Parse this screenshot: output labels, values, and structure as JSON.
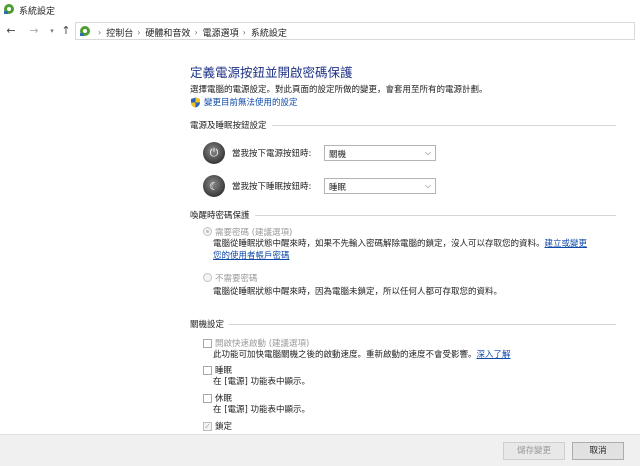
{
  "window": {
    "title": "系統設定"
  },
  "breadcrumb": {
    "items": [
      "控制台",
      "硬體和音效",
      "電源選項",
      "系統設定"
    ]
  },
  "page": {
    "heading": "定義電源按鈕並開啟密碼保護",
    "description": "選擇電腦的電源設定。對此頁面的設定所做的變更，會套用至所有的電源計劃。",
    "admin_link": "變更目前無法使用的設定"
  },
  "power_buttons": {
    "group_title": "電源及睡眠按鈕設定",
    "power_label": "當我按下電源按鈕時:",
    "power_value": "關機",
    "sleep_label": "當我按下睡眠按鈕時:",
    "sleep_value": "睡眠"
  },
  "wake_password": {
    "group_title": "喚醒時密碼保護",
    "require_label": "需要密碼 (建議選項)",
    "require_desc_1": "電腦從睡眠狀態中醒來時，如果不先輸入密碼解除電腦的鎖定，沒人可以存取您的資料。",
    "require_link_1": "建立或變更",
    "require_link_2": "您的使用者帳戶密碼",
    "no_require_label": "不需要密碼",
    "no_require_desc": "電腦從睡眠狀態中醒來時，因為電腦未鎖定，所以任何人都可存取您的資料。"
  },
  "shutdown": {
    "group_title": "關機設定",
    "fast_startup_label": "開啟快速啟動 (建議選項)",
    "fast_startup_desc": "此功能可加快電腦關機之後的啟動速度。重新啟動的速度不會受影響。",
    "fast_startup_link": "深入了解",
    "sleep_label": "睡眠",
    "sleep_desc": "在 [電源] 功能表中顯示。",
    "hibernate_label": "休眠",
    "hibernate_desc": "在 [電源] 功能表中顯示。",
    "lock_label": "鎖定"
  },
  "footer": {
    "save_label": "儲存變更",
    "cancel_label": "取消"
  },
  "colors": {
    "heading": "#1e3287",
    "link": "#0f4aa8"
  },
  "icons": {
    "window": "control-panel-icon",
    "address": "control-panel-icon",
    "admin": "uac-shield-icon",
    "power_button": "power-icon",
    "sleep_button": "moon-icon"
  }
}
